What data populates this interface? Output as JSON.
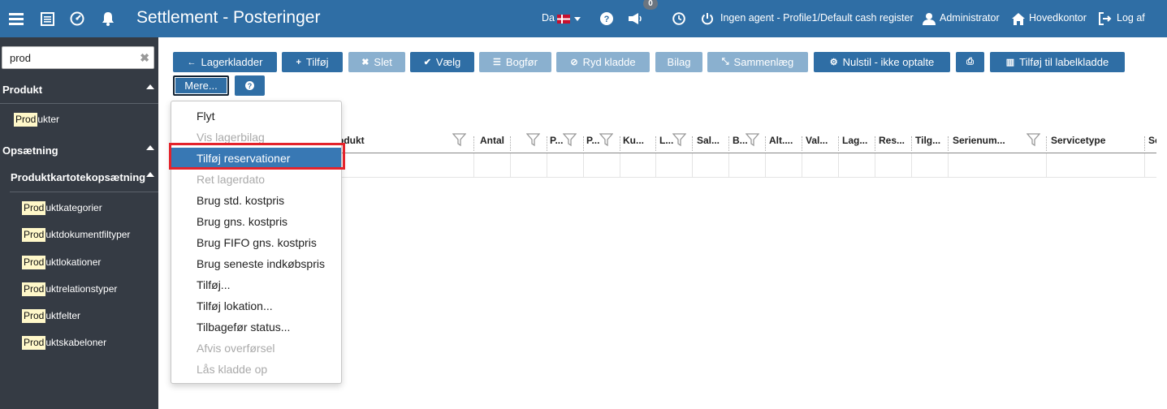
{
  "app": {
    "title": "Settlement - Posteringer"
  },
  "topbar": {
    "language": "Da",
    "announce_badge": "0",
    "agent": "Ingen agent - Profile1/Default cash register",
    "user": "Administrator",
    "office": "Hovedkontor",
    "logout": "Log af",
    "icons": [
      "menu-icon",
      "grid-icon",
      "dashboard-icon",
      "bell-icon",
      "danish-flag-icon",
      "help-icon",
      "megaphone-icon",
      "clock-icon",
      "power-icon",
      "user-icon",
      "home-icon",
      "logout-icon"
    ]
  },
  "sidebar": {
    "search": {
      "value": "prod"
    },
    "sections": [
      {
        "label": "Produkt",
        "items": [
          {
            "match": "Prod",
            "rest": "ukter"
          }
        ]
      },
      {
        "label": "Opsætning",
        "sub": {
          "label": "Produktkartotekopsætning",
          "items": [
            {
              "match": "Prod",
              "rest": "uktkategorier"
            },
            {
              "match": "Prod",
              "rest": "uktdokumentfiltyper"
            },
            {
              "match": "Prod",
              "rest": "uktlokationer"
            },
            {
              "match": "Prod",
              "rest": "uktrelationstyper"
            },
            {
              "match": "Prod",
              "rest": "uktfelter"
            },
            {
              "match": "Prod",
              "rest": "uktskabeloner"
            }
          ]
        }
      }
    ]
  },
  "toolbar": {
    "buttons": [
      {
        "label": "Lagerkladder",
        "icon": "←"
      },
      {
        "label": "Tilføj",
        "icon": "+"
      },
      {
        "label": "Slet",
        "icon": "✖"
      },
      {
        "label": "Vælg",
        "icon": "✔"
      },
      {
        "label": "Bogfør",
        "icon": "☰"
      },
      {
        "label": "Ryd kladde",
        "icon": "⊘"
      },
      {
        "label": "Bilag",
        "icon": ""
      },
      {
        "label": "Sammenlæg",
        "icon": "⤡"
      },
      {
        "label": "Nulstil - ikke optalte",
        "icon": "⚙"
      },
      {
        "label": "",
        "icon": "⎙"
      },
      {
        "label": "Tilføj til labelkladde",
        "icon": "▥"
      }
    ],
    "more_label": "Mere...",
    "help_icon": "?"
  },
  "grid": {
    "columns": [
      "odukt",
      "Antal",
      "P...",
      "P...",
      "Ku...",
      "L...",
      "Sal...",
      "B...",
      "Alt....",
      "Val...",
      "Lag...",
      "Res...",
      "Tilg...",
      "Serienum...",
      "Servicetype",
      "Se"
    ]
  },
  "menu": {
    "items": [
      {
        "label": "Flyt",
        "enabled": true
      },
      {
        "label": "Vis lagerbilag",
        "enabled": false
      },
      {
        "label": "Tilføj reservationer",
        "enabled": true,
        "selected": true
      },
      {
        "label": "Ret lagerdato",
        "enabled": false
      },
      {
        "label": "Brug std. kostpris",
        "enabled": true
      },
      {
        "label": "Brug gns. kostpris",
        "enabled": true
      },
      {
        "label": "Brug FIFO gns. kostpris",
        "enabled": true
      },
      {
        "label": "Brug seneste indkøbspris",
        "enabled": true
      },
      {
        "label": "Tilføj...",
        "enabled": true
      },
      {
        "label": "Tilføj lokation...",
        "enabled": true
      },
      {
        "label": "Tilbagefør status...",
        "enabled": true
      },
      {
        "label": "Afvis overførsel",
        "enabled": false
      },
      {
        "label": "Lås kladde op",
        "enabled": false
      }
    ]
  },
  "colors": {
    "topbar": "#2f6ea5",
    "sidebar": "#353b44",
    "button": "#2f6ea5",
    "button_disabled": "#8ab0cf",
    "highlight_outline": "#e4232b",
    "menu_selected": "#3878b4"
  }
}
